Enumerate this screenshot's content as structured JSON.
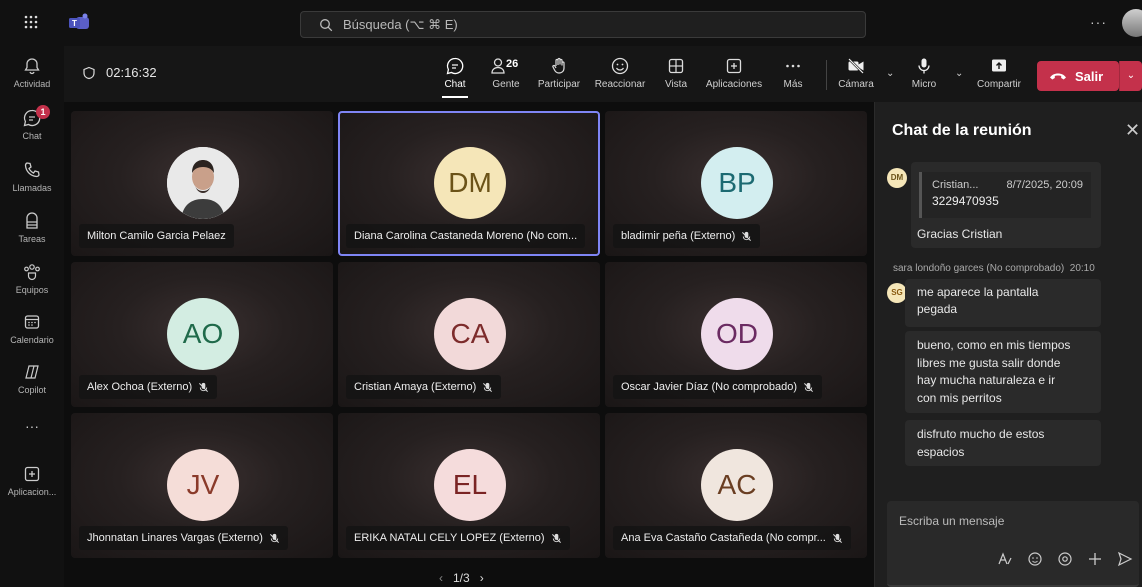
{
  "topbar": {
    "search_placeholder": "Búsqueda (⌥ ⌘ E)",
    "more": "···"
  },
  "rail": {
    "items": [
      {
        "label": "Actividad",
        "icon": "bell-icon"
      },
      {
        "label": "Chat",
        "icon": "chat-icon",
        "badge": "1"
      },
      {
        "label": "Llamadas",
        "icon": "phone-icon"
      },
      {
        "label": "Tareas",
        "icon": "tasks-icon"
      },
      {
        "label": "Equipos",
        "icon": "teams-icon"
      },
      {
        "label": "Calendario",
        "icon": "calendar-icon"
      },
      {
        "label": "Copilot",
        "icon": "copilot-icon"
      },
      {
        "label": "···",
        "icon": "more-icon"
      },
      {
        "label": "Aplicacion...",
        "icon": "apps-icon"
      }
    ]
  },
  "meeting": {
    "timer": "02:16:32",
    "toolbar": {
      "chat": "Chat",
      "people": "Gente",
      "people_count": "26",
      "raise": "Participar",
      "react": "Reaccionar",
      "view": "Vista",
      "apps": "Aplicaciones",
      "more": "Más",
      "camera": "Cámara",
      "mic": "Micro",
      "share": "Compartir",
      "leave": "Salir"
    },
    "participants": [
      {
        "name": "Milton Camilo Garcia Pelaez",
        "initials": "",
        "photo": true,
        "muted": false
      },
      {
        "name": "Diana Carolina Castaneda Moreno (No com...",
        "initials": "DM",
        "bg": "#f5e6b8",
        "fg": "#6b5318",
        "muted": false,
        "selected": true
      },
      {
        "name": "bladimir peña (Externo)",
        "initials": "BP",
        "bg": "#d3eef0",
        "fg": "#1c6a72",
        "muted": true
      },
      {
        "name": "Alex Ochoa (Externo)",
        "initials": "AO",
        "bg": "#d3ede2",
        "fg": "#1f6a4a",
        "muted": true
      },
      {
        "name": "Cristian Amaya (Externo)",
        "initials": "CA",
        "bg": "#f2d9d9",
        "fg": "#7d2c2c",
        "muted": true
      },
      {
        "name": "Oscar Javier Díaz (No comprobado)",
        "initials": "OD",
        "bg": "#efdceb",
        "fg": "#6b2b62",
        "muted": true
      },
      {
        "name": "Jhonnatan Linares Vargas (Externo)",
        "initials": "JV",
        "bg": "#f5ddd8",
        "fg": "#8a3a2a",
        "muted": true
      },
      {
        "name": "ERIKA NATALI CELY LOPEZ (Externo)",
        "initials": "EL",
        "bg": "#f5dcdc",
        "fg": "#7a2424",
        "muted": true
      },
      {
        "name": "Ana Eva Castaño Castañeda (No compr...",
        "initials": "AC",
        "bg": "#f0e6de",
        "fg": "#6a3e22",
        "muted": true
      }
    ],
    "pager": "1/3"
  },
  "chat": {
    "title": "Chat de la reunión",
    "messages": {
      "dm_avatar": "DM",
      "quote_author": "Cristian...",
      "quote_time": "8/7/2025, 20:09",
      "quote_text": "3229470935",
      "reply": "Gracias Cristian",
      "sender": "sara londoño garces (No comprobado)",
      "sender_time": "20:10",
      "sg_avatar": "SG",
      "m1_line1": "me aparece la pantalla",
      "m1_line2": "pegada",
      "m2_line1": "bueno, como en mis tiempos",
      "m2_line2": "libres me gusta salir donde",
      "m2_line3": "hay mucha naturaleza e ir",
      "m2_line4": "con mis perritos",
      "m3_line1": "disfruto mucho de estos",
      "m3_line2": "espacios"
    },
    "compose_placeholder": "Escriba un mensaje"
  }
}
